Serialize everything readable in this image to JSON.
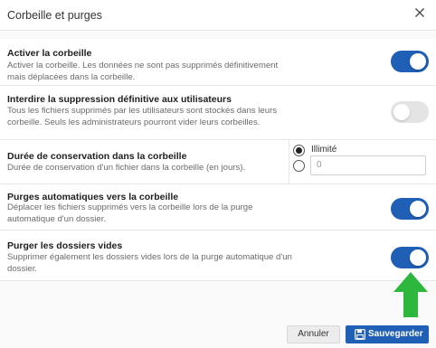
{
  "dialog": {
    "title": "Corbeille et purges",
    "close_icon": "close-icon"
  },
  "settings": [
    {
      "title": "Activer la corbeille",
      "description": "Activer la corbeille. Les données ne sont pas supprimés définitivement mais déplacées dans la corbeille.",
      "enabled": true
    },
    {
      "title": "Interdire la suppression définitive aux utilisateurs",
      "description": "Tous les fichiers supprimés par les utilisateurs sont stockés dans leurs corbeille. Seuls les administrateurs pourront vider leurs corbeilles.",
      "enabled": false
    },
    {
      "title": "Durée de conservation dans la corbeille",
      "description": "Durée de conservation d'un fichier dans la corbeille (en jours).",
      "options": {
        "unlimited_label": "Illimité",
        "unlimited_selected": true,
        "days_placeholder": "0"
      }
    },
    {
      "title": "Purges automatiques vers la corbeille",
      "description": "Déplacer les fichiers supprimés vers la corbeille lors de la purge automatique d'un dossier.",
      "enabled": true
    },
    {
      "title": "Purger les dossiers vides",
      "description": "Supprimer également les dossiers vides lors de la purge automatique d'un dossier.",
      "enabled": true
    }
  ],
  "footer": {
    "cancel_label": "Annuler",
    "save_label": "Sauvegarder",
    "save_icon": "save-icon"
  },
  "annotation": {
    "arrow_icon": "arrow-up-icon",
    "arrow_color": "#2db83d"
  },
  "colors": {
    "accent": "#1f5fb6",
    "toggle_off": "#e4e4e4"
  }
}
